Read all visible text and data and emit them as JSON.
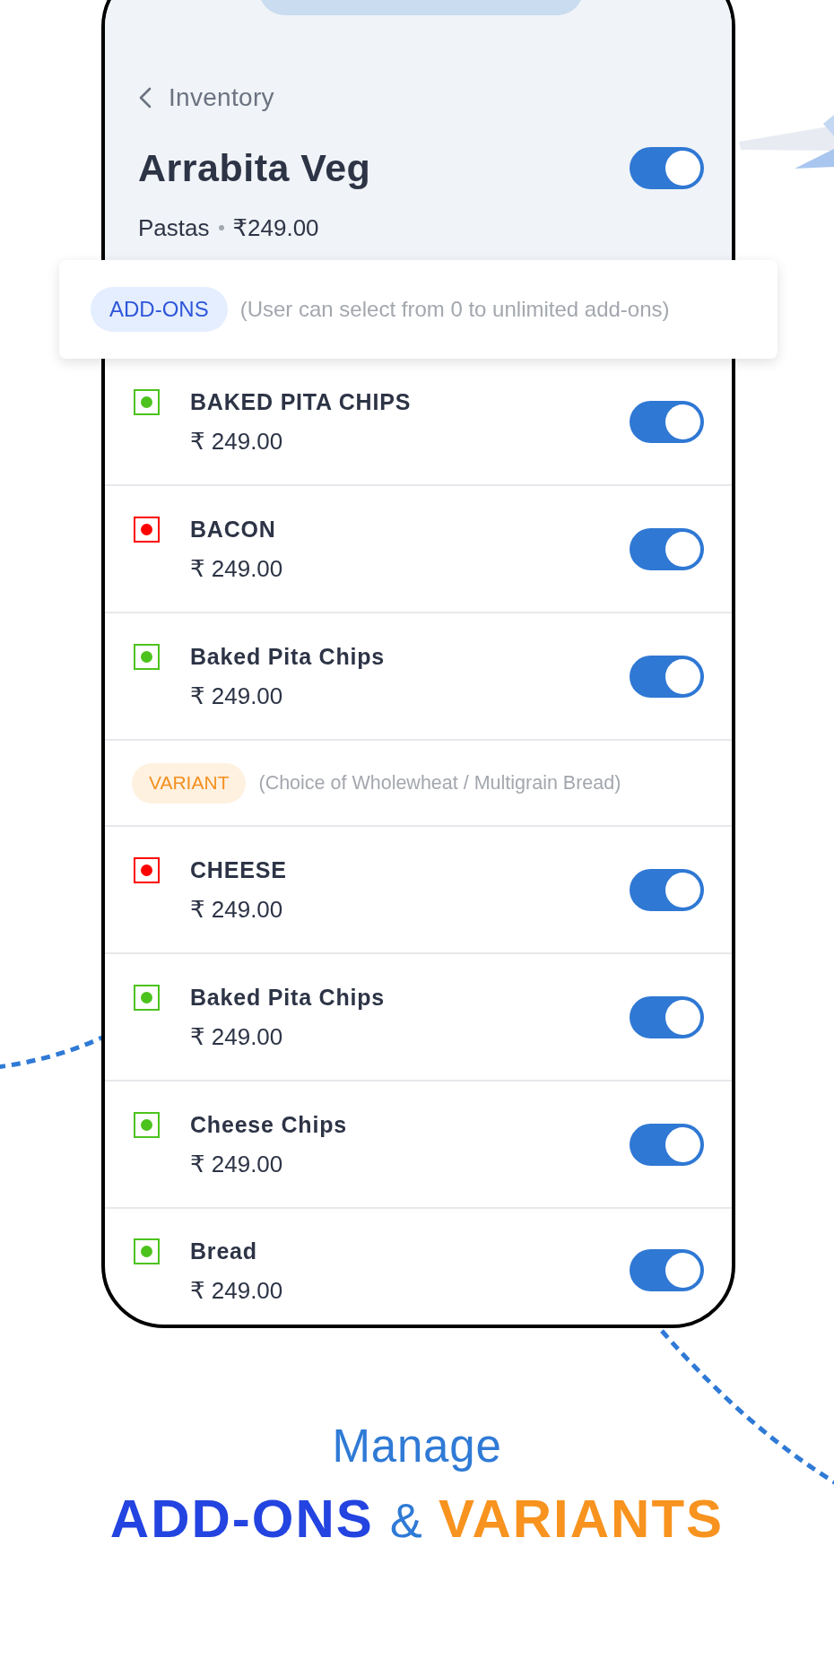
{
  "header": {
    "back_label": "Inventory",
    "title": "Arrabita Veg",
    "on": true,
    "category": "Pastas",
    "price": "₹249.00"
  },
  "groups": [
    {
      "kind": "addons",
      "tag": "ADD-ONS",
      "description": "(User can select from 0 to unlimited add-ons)",
      "items": [
        {
          "name": "BAKED PITA CHIPS",
          "price": "₹ 249.00",
          "color": "#4cc31d",
          "on": true
        },
        {
          "name": "BACON",
          "price": "₹ 249.00",
          "color": "#ff0000",
          "on": true
        },
        {
          "name": "Baked Pita Chips",
          "price": "₹ 249.00",
          "color": "#4cc31d",
          "on": true
        }
      ]
    },
    {
      "kind": "variant",
      "tag": "VARIANT",
      "description": "(Choice of Wholewheat / Multigrain Bread)",
      "items": [
        {
          "name": "CHEESE",
          "price": "₹ 249.00",
          "color": "#ff0000",
          "on": true
        },
        {
          "name": "Baked Pita Chips",
          "price": "₹ 249.00",
          "color": "#4cc31d",
          "on": true
        },
        {
          "name": "Cheese Chips",
          "price": "₹ 249.00",
          "color": "#4cc31d",
          "on": true
        },
        {
          "name": "Bread",
          "price": "₹ 249.00",
          "color": "#4cc31d",
          "on": true
        }
      ]
    }
  ],
  "footer": {
    "lead": "Manage",
    "headline": [
      {
        "text": "ADD-ONS",
        "kind": "word",
        "color": "#2344e0"
      },
      {
        "text": "&",
        "kind": "joiner",
        "color": "#2f7ad6"
      },
      {
        "text": "VARIANTS",
        "kind": "word",
        "color": "#f7931e"
      }
    ]
  }
}
